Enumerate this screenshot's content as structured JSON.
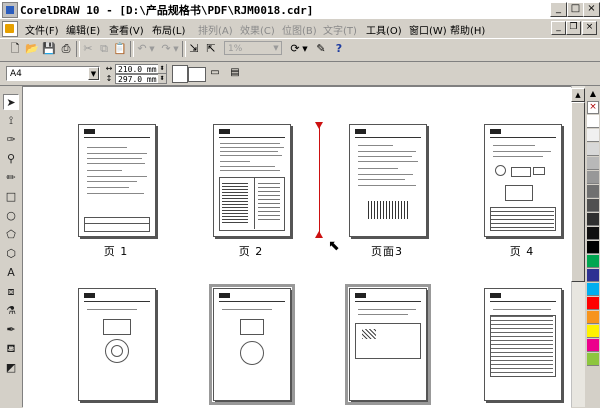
{
  "window": {
    "title": "CorelDRAW 10 - [D:\\产品规格书\\PDF\\RJM0018.cdr]",
    "minimize_icon": "minimize-icon",
    "maximize_icon": "maximize-icon",
    "close_icon": "close-icon"
  },
  "menu": {
    "items": [
      {
        "label": "文件(F)",
        "enabled": true
      },
      {
        "label": "编辑(E)",
        "enabled": true
      },
      {
        "label": "查看(V)",
        "enabled": true
      },
      {
        "label": "布局(L)",
        "enabled": true
      },
      {
        "label": "排列(A)",
        "enabled": false
      },
      {
        "label": "效果(C)",
        "enabled": false
      },
      {
        "label": "位图(B)",
        "enabled": false
      },
      {
        "label": "文字(T)",
        "enabled": false
      },
      {
        "label": "工具(O)",
        "enabled": true
      },
      {
        "label": "窗口(W)",
        "enabled": true
      },
      {
        "label": "帮助(H)",
        "enabled": true
      }
    ]
  },
  "toolbar": {
    "zoom_value": "1%"
  },
  "property_bar": {
    "paper_size": "A4",
    "width": "210.0 mm",
    "height": "297.0 mm"
  },
  "pages": {
    "labels": [
      "页 1",
      "页 2",
      "页面3",
      "页 4"
    ]
  },
  "palette": {
    "colors": [
      "#ffffff",
      "#f0f0f0",
      "#d8d8d8",
      "#b8b8b8",
      "#989898",
      "#707070",
      "#505050",
      "#303030",
      "#101010",
      "#000000",
      "#00a651",
      "#2e3192",
      "#00aeef",
      "#ff0000",
      "#f7941d",
      "#fff200",
      "#ec008c",
      "#8dc63f"
    ]
  }
}
